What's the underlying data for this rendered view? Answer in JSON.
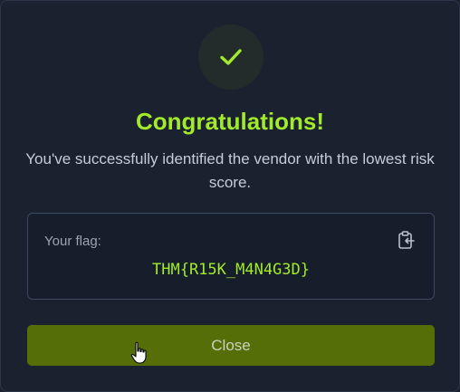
{
  "dialog": {
    "title": "Congratulations!",
    "message": "You've successfully identified the vendor with the lowest risk score.",
    "flag_label": "Your flag:",
    "flag_value": "THM{R15K_M4N4G3D}",
    "close_label": "Close"
  },
  "icons": {
    "status": "check-icon",
    "copy": "clipboard-copy-icon",
    "cursor": "hand-pointer-cursor"
  },
  "colors": {
    "background": "#1a2230",
    "accent": "#a3ea2a",
    "button": "#566e07",
    "text": "#c3ccd8"
  }
}
